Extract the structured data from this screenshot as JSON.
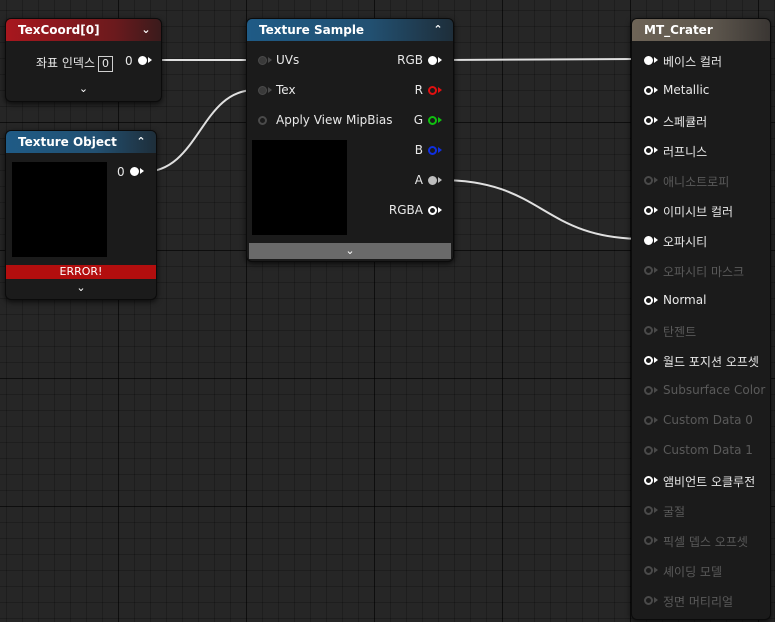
{
  "texcoord_node": {
    "title": "TexCoord[0]",
    "input_label": "좌표 인덱스",
    "input_value": "0",
    "output_label": "0"
  },
  "texture_object_node": {
    "title": "Texture Object",
    "output_label": "0",
    "error_text": "ERROR!"
  },
  "texture_sample_node": {
    "title": "Texture Sample",
    "inputs": [
      "UVs",
      "Tex",
      "Apply View MipBias"
    ],
    "outputs": [
      "RGB",
      "R",
      "G",
      "B",
      "A",
      "RGBA"
    ],
    "output_colors": [
      "#ffffff",
      "#e01010",
      "#10c010",
      "#1030e0",
      "#bdbdbd",
      "#ffffff"
    ]
  },
  "material_node": {
    "title": "MT_Crater",
    "inputs": [
      {
        "label": "베이스 컬러",
        "state": "connected"
      },
      {
        "label": "Metallic",
        "state": "active"
      },
      {
        "label": "스페큘러",
        "state": "active"
      },
      {
        "label": "러프니스",
        "state": "active"
      },
      {
        "label": "애니소트로피",
        "state": "disabled"
      },
      {
        "label": "이미시브 컬러",
        "state": "active"
      },
      {
        "label": "오파시티",
        "state": "connected"
      },
      {
        "label": "오파시티 마스크",
        "state": "disabled"
      },
      {
        "label": "Normal",
        "state": "active"
      },
      {
        "label": "탄젠트",
        "state": "disabled"
      },
      {
        "label": "월드 포지션 오프셋",
        "state": "active"
      },
      {
        "label": "Subsurface Color",
        "state": "disabled"
      },
      {
        "label": "Custom Data 0",
        "state": "disabled"
      },
      {
        "label": "Custom Data 1",
        "state": "disabled"
      },
      {
        "label": "앰비언트 오클루전",
        "state": "active"
      },
      {
        "label": "굴절",
        "state": "disabled"
      },
      {
        "label": "픽셀 뎁스 오프셋",
        "state": "disabled"
      },
      {
        "label": "셰이딩 모델",
        "state": "disabled"
      },
      {
        "label": "정면 머티리얼",
        "state": "disabled"
      }
    ]
  },
  "colors": {
    "wire": "#e0e0e0",
    "error": "#b30e0e"
  }
}
